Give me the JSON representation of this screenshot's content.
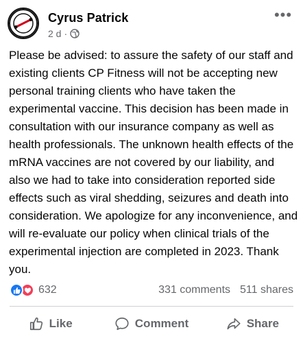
{
  "post": {
    "author": "Cyrus Patrick",
    "time": "2 d",
    "separator": "·",
    "audience_icon": "globe-icon",
    "more_icon": "more-options-icon",
    "more_glyph": "•••",
    "text": "Please be advised: to assure the safety of our staff and existing clients CP Fitness will not be accepting new personal training clients who have taken the experimental vaccine. This decision has been made in consultation with our insurance company as well as health professionals. The unknown health effects of the mRNA vaccines are not covered by our liability, and also we had to take into consideration reported side effects such as viral shedding, seizures and death into consideration. We apologize for any inconvenience, and will re-evaluate our policy when clinical trials of the experimental injection are completed in 2023. Thank you."
  },
  "stats": {
    "reaction_icons": [
      "like-reaction-icon",
      "love-reaction-icon"
    ],
    "reaction_count": "632",
    "comments": "331 comments",
    "shares": "511 shares"
  },
  "actions": {
    "like_label": "Like",
    "comment_label": "Comment",
    "share_label": "Share"
  },
  "colors": {
    "like_blue": "#1877f2",
    "love_red": "#f33e58",
    "secondary_text": "#65676b"
  }
}
